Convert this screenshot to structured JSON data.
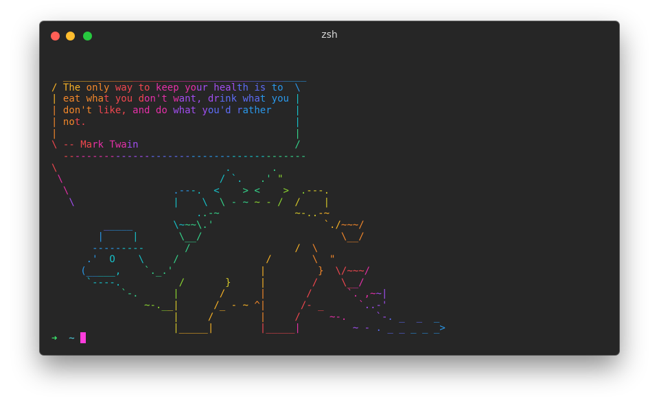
{
  "window": {
    "title": "zsh",
    "buttons": [
      "close",
      "minimize",
      "zoom"
    ]
  },
  "terminal": {
    "quote": "The only way to keep your health is to eat what you don't want, drink what you don't like, and do what you'd rather not.",
    "attribution": "-- Mark Twain",
    "output_lines": [
      "  __________________________________________",
      "/ The only way to keep your health is to  \\",
      "| eat what you don't want, drink what you |",
      "| don't like, and do what you'd rather    |",
      "| not.                                    |",
      "|                                         |",
      "\\ -- Mark Twain                           /",
      "  ------------------------------------------",
      "\\                             .       .",
      " \\                           / `.   .' \"",
      "  \\                  .---.  <    > <    >  .---.",
      "   \\                 |    \\  \\ - ~ ~ - /  /    |",
      "                         ..-~             ~-..-~",
      "         _____       \\~~~\\.'                   `./~~~/",
      "        |     |       \\__/                        \\__/",
      "       ---------       /                  /  \\",
      "      .'  O    \\     /               /       \\  \"",
      "     (_____,    `._.'               |         }  \\/~~~/",
      "      `----.          /       }     |        /    \\__/",
      "            `-.      |       /      |       /      `. ,~~|",
      "                ~-.__|      /_ - ~ ^|      /- _      `..-'",
      "                     |     /        |     /     ~-.     `-. _  _  _",
      "                     |_____|        |_____|         ~ - . _ _ _ _ _>"
    ],
    "prompt_arrow": "➜",
    "prompt_dir": "~"
  },
  "colors": {
    "terminal_bg": "#262626",
    "rainbow": [
      "#f7b226",
      "#f2872b",
      "#f0474f",
      "#e530a8",
      "#a14ef0",
      "#5d6cf5",
      "#2a98ea",
      "#17c1c9",
      "#35d38a",
      "#8bd431",
      "#d4c72a"
    ],
    "cursor": "#ff3cdc",
    "prompt_arrow": "#3be36b",
    "prompt_dir": "#4fd1e0"
  }
}
